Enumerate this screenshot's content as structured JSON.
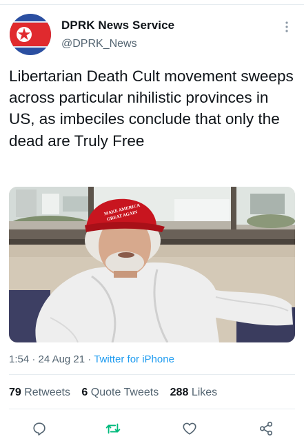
{
  "account": {
    "name": "DPRK News Service",
    "handle": "@DPRK_News"
  },
  "tweet": {
    "text": "Libertarian Death Cult movement sweeps across particular nihilistic provinces in US, as imbeciles conclude that only the dead are Truly Free"
  },
  "media": {
    "hat_text_line1": "MAKE AMERICA",
    "hat_text_line2": "GREAT AGAIN"
  },
  "meta": {
    "time": "1:54",
    "date": "24 Aug 21",
    "separator": "·",
    "source": "Twitter for iPhone"
  },
  "stats": {
    "retweets_count": "79",
    "retweets_label": "Retweets",
    "quotes_count": "6",
    "quotes_label": "Quote Tweets",
    "likes_count": "288",
    "likes_label": "Likes"
  },
  "icons": {
    "avatar": "north-korea-flag-icon",
    "more": "more-vertical-icon",
    "reply": "reply-icon",
    "retweet": "retweet-icon",
    "like": "heart-icon",
    "share": "share-icon"
  },
  "colors": {
    "link": "#1d9bf0",
    "retweet_green": "#00ba7c",
    "secondary_text": "#536471",
    "flag_red": "#e02a2e",
    "flag_blue": "#2b4fa1"
  }
}
